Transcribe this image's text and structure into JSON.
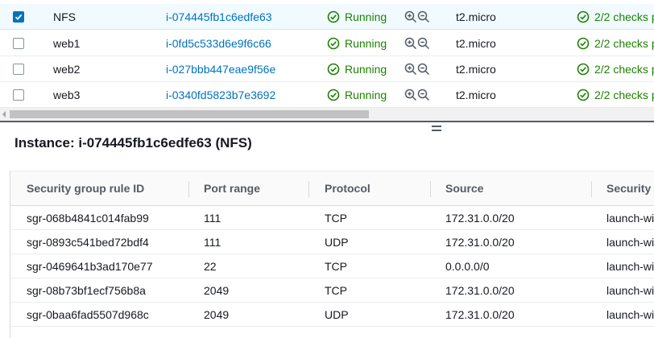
{
  "instances": [
    {
      "name": "NFS",
      "id": "i-074445fb1c6edfe63",
      "state": "Running",
      "type": "t2.micro",
      "checks": "2/2 checks p",
      "selected": true
    },
    {
      "name": "web1",
      "id": "i-0fd5c533d6e9f6c66",
      "state": "Running",
      "type": "t2.micro",
      "checks": "2/2 checks p",
      "selected": false
    },
    {
      "name": "web2",
      "id": "i-027bbb447eae9f56e",
      "state": "Running",
      "type": "t2.micro",
      "checks": "2/2 checks p",
      "selected": false
    },
    {
      "name": "web3",
      "id": "i-0340fd5823b7e3692",
      "state": "Running",
      "type": "t2.micro",
      "checks": "2/2 checks p",
      "selected": false
    }
  ],
  "detail": {
    "title": "Instance: i-074445fb1c6edfe63 (NFS)",
    "columns": [
      "Security group rule ID",
      "Port range",
      "Protocol",
      "Source",
      "Security g"
    ],
    "rules": [
      {
        "rule_id": "sgr-068b4841c014fab99",
        "port": "111",
        "protocol": "TCP",
        "source": "172.31.0.0/20",
        "group": "launch-wi"
      },
      {
        "rule_id": "sgr-0893c541bed72bdf4",
        "port": "111",
        "protocol": "UDP",
        "source": "172.31.0.0/20",
        "group": "launch-wi"
      },
      {
        "rule_id": "sgr-0469641b3ad170e77",
        "port": "22",
        "protocol": "TCP",
        "source": "0.0.0.0/0",
        "group": "launch-wi"
      },
      {
        "rule_id": "sgr-08b73bf1ecf756b8a",
        "port": "2049",
        "protocol": "TCP",
        "source": "172.31.0.0/20",
        "group": "launch-wi"
      },
      {
        "rule_id": "sgr-0baa6fad5507d968c",
        "port": "2049",
        "protocol": "UDP",
        "source": "172.31.0.0/20",
        "group": "launch-wi"
      }
    ]
  },
  "colors": {
    "link": "#0073bb",
    "success": "#1d8102",
    "selected_row": "#f1faff"
  },
  "icons": [
    "check-icon",
    "running-status-icon",
    "zoom-in-icon",
    "zoom-out-icon",
    "status-check-icon"
  ]
}
